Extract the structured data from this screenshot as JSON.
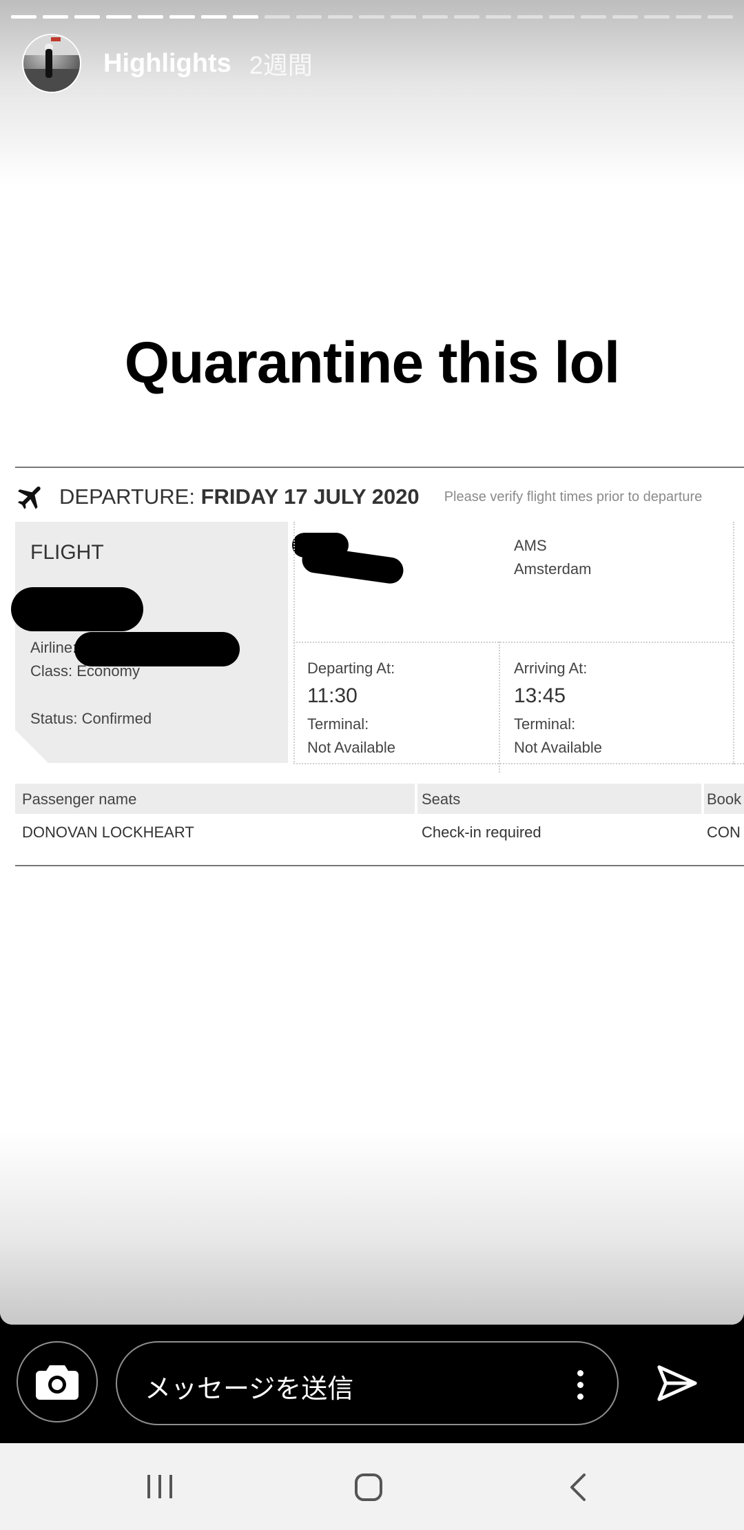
{
  "story": {
    "progress_segments_total": 23,
    "progress_segments_done": 8,
    "username": "Highlights",
    "time_ago": "2週間",
    "caption": "Quarantine this lol"
  },
  "itinerary": {
    "departure_prefix": "DEPARTURE:",
    "departure_date": "FRIDAY 17 JULY 2020",
    "departure_note": "Please verify flight times prior to departure",
    "flight_title": "FLIGHT",
    "airline_label": "Airline:",
    "class_text": "Class: Economy",
    "status_text": "Status: Confirmed",
    "arrival_code": "AMS",
    "arrival_city": "Amsterdam",
    "departing_label": "Departing At:",
    "departing_time": "11:30",
    "departing_terminal_label": "Terminal:",
    "departing_terminal": "Not Available",
    "arriving_label": "Arriving At:",
    "arriving_time": "13:45",
    "arriving_terminal_label": "Terminal:",
    "arriving_terminal": "Not Available",
    "passenger_header": "Passenger name",
    "seats_header": "Seats",
    "booking_header": "Book",
    "passenger_name": "DONOVAN LOCKHEART",
    "seats_value": "Check-in required",
    "booking_value": "CON"
  },
  "message_bar": {
    "placeholder": "メッセージを送信",
    "camera_icon": "camera-icon",
    "more_icon": "more-vertical-icon",
    "send_icon": "send-icon"
  },
  "nav_bar": {
    "recent_icon": "recent-apps-icon",
    "home_icon": "home-icon",
    "back_icon": "back-icon"
  }
}
